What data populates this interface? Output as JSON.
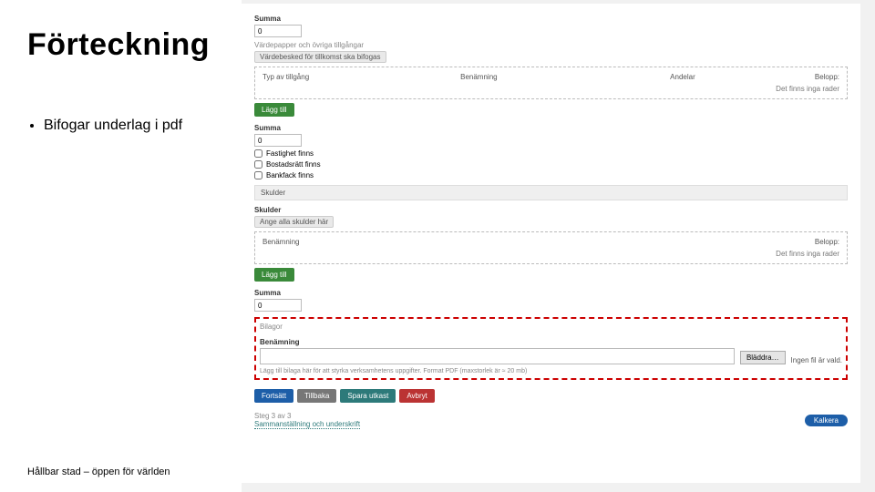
{
  "left": {
    "title": "Förteckning",
    "bullets": [
      "Bifogar underlag i pdf"
    ],
    "footer": "Hållbar stad – öppen för världen"
  },
  "form": {
    "summa_label": "Summa",
    "summa_value": "0",
    "assets": {
      "heading": "Värdepapper och övriga tillgångar",
      "tag": "Värdebesked för tillkomst ska bifogas",
      "cols": [
        "Typ av tillgång",
        "Benämning",
        "Andelar",
        "Belopp:"
      ],
      "empty": "Det finns inga rader",
      "add": "Lägg till"
    },
    "checks": [
      "Fastighet finns",
      "Bostadsrätt finns",
      "Bankfack finns"
    ],
    "skulder": {
      "section": "Skulder",
      "heading": "Skulder",
      "tag": "Ange alla skulder här",
      "cols": [
        "Benämning",
        "Belopp:"
      ],
      "empty": "Det finns inga rader",
      "add": "Lägg till"
    },
    "bilagor": {
      "heading": "Bilagor",
      "label": "Benämning",
      "browse": "Bläddra…",
      "file_status": "Ingen fil är vald.",
      "note": "Lägg till bilaga här för att styrka verksamhetens uppgifter. Format PDF (maxstorlek är ≈ 20 mb)"
    },
    "buttons": {
      "fortsatt": "Fortsätt",
      "tillbaka": "Tillbaka",
      "spara": "Spara utkast",
      "avbryt": "Avbryt"
    },
    "next_step": {
      "label": "Steg 3 av 3",
      "name": "Sammanställning och underskrift",
      "submit": "Kalkera"
    }
  }
}
